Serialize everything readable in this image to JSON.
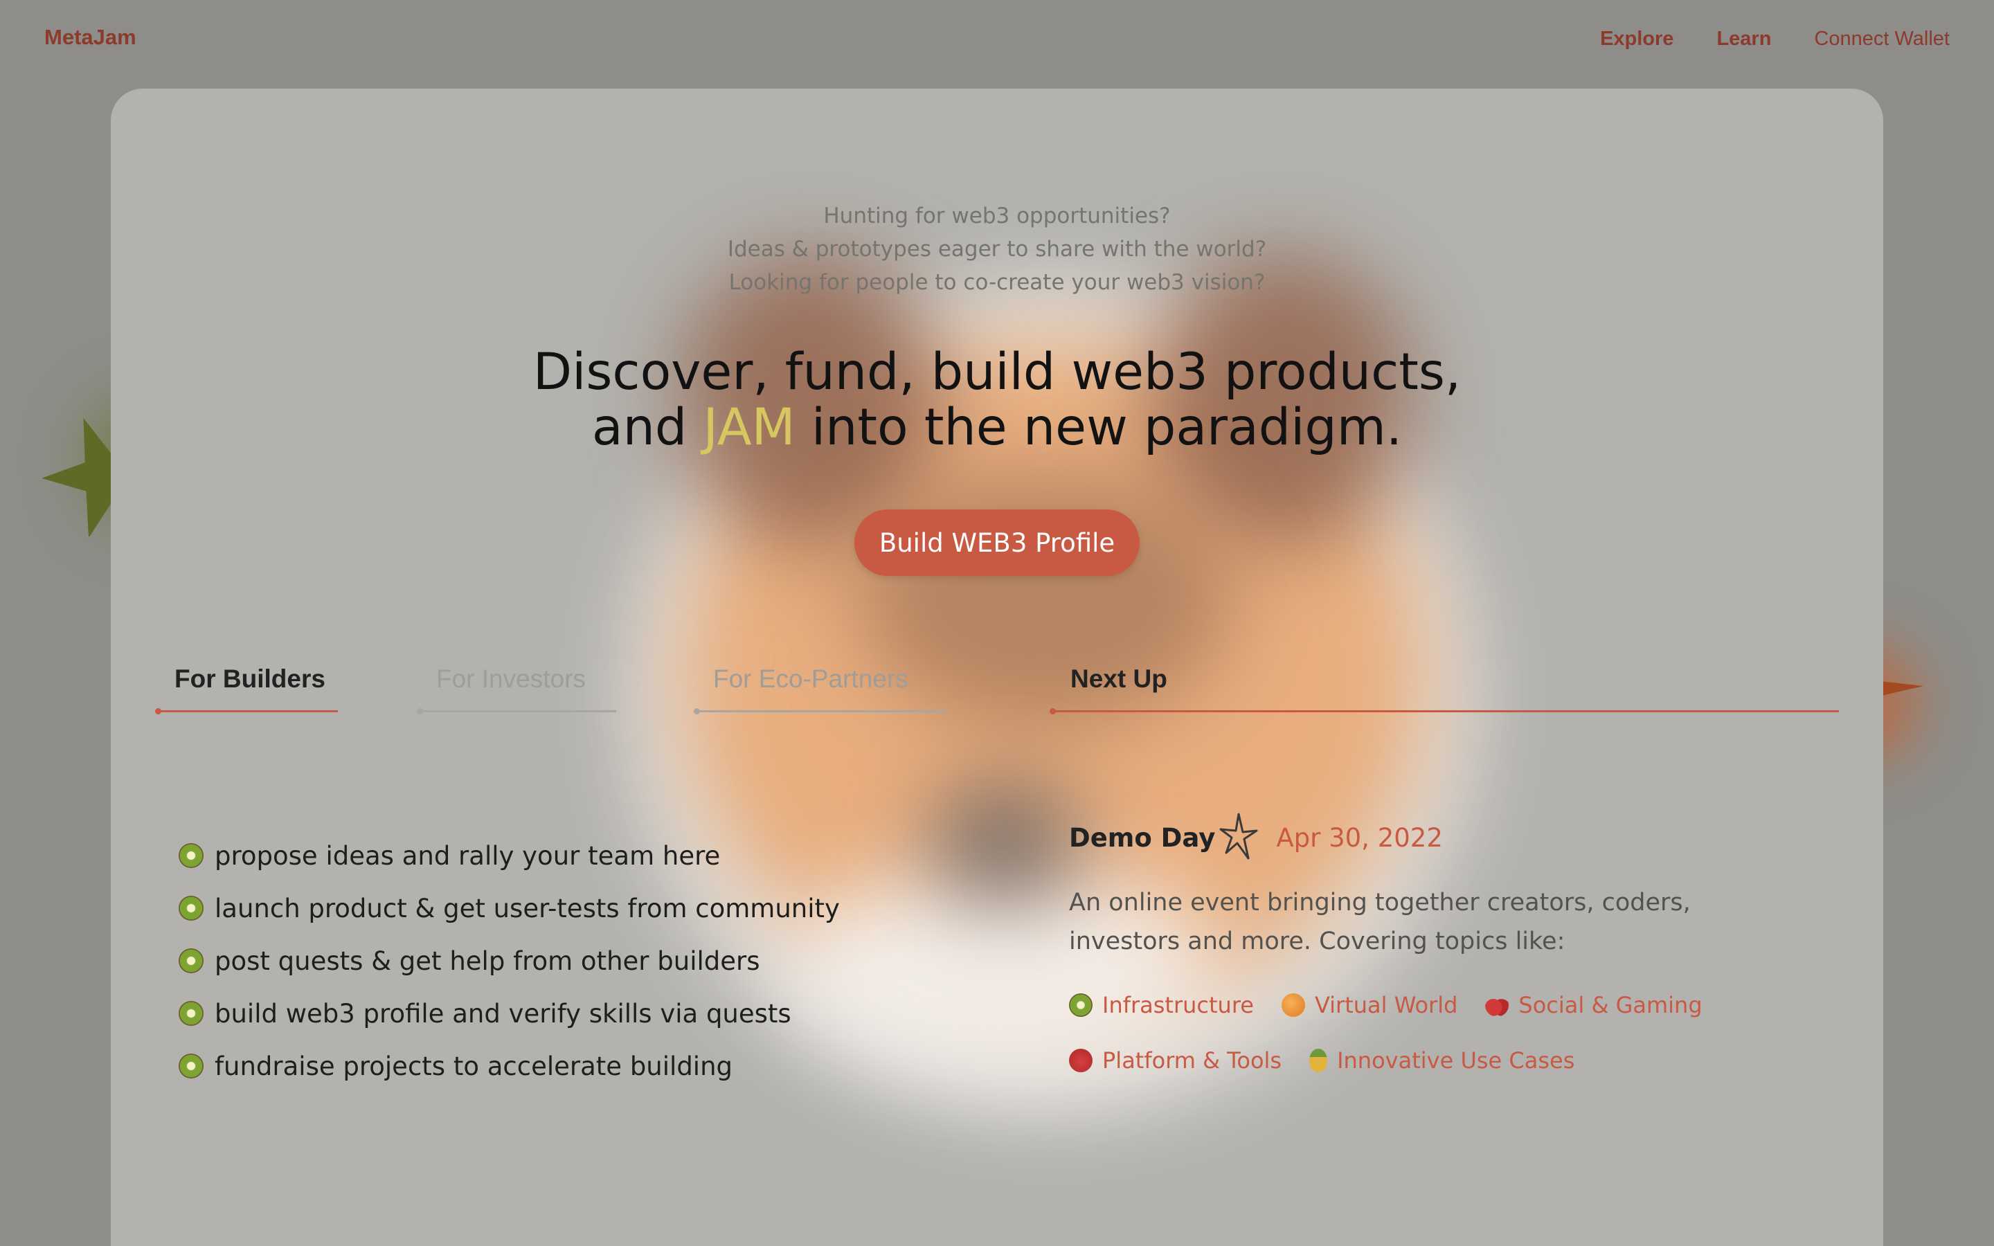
{
  "header": {
    "brand": "MetaJam",
    "nav": [
      {
        "label": "Explore"
      },
      {
        "label": "Learn"
      },
      {
        "label": "Connect Wallet"
      }
    ]
  },
  "hero": {
    "subtitle_lines": [
      "Hunting for web3 opportunities?",
      "Ideas & prototypes eager to share with the world?",
      "Looking for people to co-create your web3 vision?"
    ],
    "headline_line1": "Discover, fund, build web3 products,",
    "headline_line2_pre": "and ",
    "headline_highlight": "JAM",
    "headline_line2_post": " into the new paradigm.",
    "cta_label": "Build WEB3 Profile"
  },
  "tabs": [
    {
      "label": "For Builders",
      "active": true
    },
    {
      "label": "For Investors",
      "active": false
    },
    {
      "label": "For Eco-Partners",
      "active": false
    }
  ],
  "builders": [
    "propose ideas and rally your team here",
    "launch product & get user-tests from community",
    "post quests & get help from other builders",
    "build web3 profile and verify skills via quests",
    "fundraise projects to accelerate building"
  ],
  "next_up": {
    "title": "Next Up",
    "event_name": "Demo Day",
    "event_date": "Apr 30, 2022",
    "description": "An online event bringing together creators, coders, investors and more. Covering topics like:",
    "topics": [
      {
        "label": "Infrastructure",
        "icon": "kiwi-icon"
      },
      {
        "label": "Virtual World",
        "icon": "orange-icon"
      },
      {
        "label": "Social & Gaming",
        "icon": "cherry-icon"
      },
      {
        "label": "Platform & Tools",
        "icon": "strawberry-icon"
      },
      {
        "label": "Innovative Use Cases",
        "icon": "pineapple-icon"
      }
    ]
  },
  "colors": {
    "accent": "#c85a44",
    "highlight": "#d6c760",
    "brand": "#8c3a2c"
  }
}
